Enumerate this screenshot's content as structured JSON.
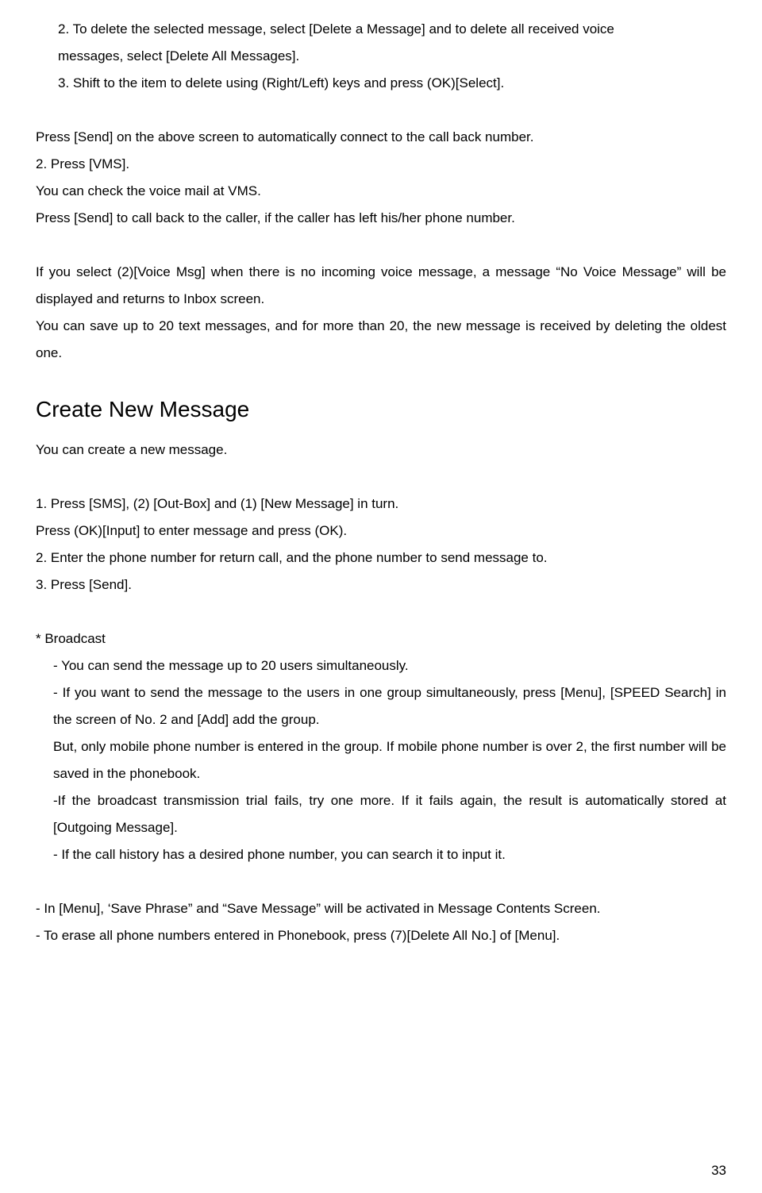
{
  "p1": "2. To delete the selected message, select [Delete a Message] and to delete all received voice",
  "p2": "messages, select [Delete All Messages].",
  "p3": "3.  Shift to the item to delete using (Right/Left) keys and press (OK)[Select].",
  "p4": "Press [Send] on the above screen to automatically connect to the call back number.",
  "p5": "2. Press [VMS].",
  "p6": "You can check the voice mail at VMS.",
  "p7": "Press [Send] to call back to the caller, if the caller has left his/her phone number.",
  "p8": "If you select (2)[Voice Msg] when there is no incoming voice message, a message “No Voice Message” will be displayed and returns to Inbox screen.",
  "p9": "You can save up to 20 text messages, and for more than 20, the new message is received by deleting the oldest one.",
  "heading1": "Create New Message",
  "p10": "You can create a new message.",
  "p11": "1. Press [SMS], (2) [Out-Box] and (1) [New Message] in turn.",
  "p12": "Press (OK)[Input] to enter message and press (OK).",
  "p13": "2. Enter the phone number for return call, and the phone number to send message to.",
  "p14": "3. Press [Send].",
  "p15": "* Broadcast",
  "p16": "- You can send the message up to 20 users simultaneously.",
  "p17": "- If you want to send the message to the users in one group simultaneously, press [Menu], [SPEED Search] in the screen of No. 2 and [Add] add the group.",
  "p18": "But, only mobile phone number is entered in the group. If mobile phone number is over 2, the first number will be saved in the phonebook.",
  "p19": "-If the broadcast transmission trial fails, try one more. If it fails again, the result is automatically stored at [Outgoing Message].",
  "p20": "- If the call history has a desired phone number, you can search it to input it.",
  "p21": "- In [Menu], ‘Save Phrase” and “Save Message” will be activated in Message Contents Screen.",
  "p22": "- To erase all phone numbers entered in Phonebook, press (7)[Delete All No.] of [Menu].",
  "pageNumber": "33"
}
